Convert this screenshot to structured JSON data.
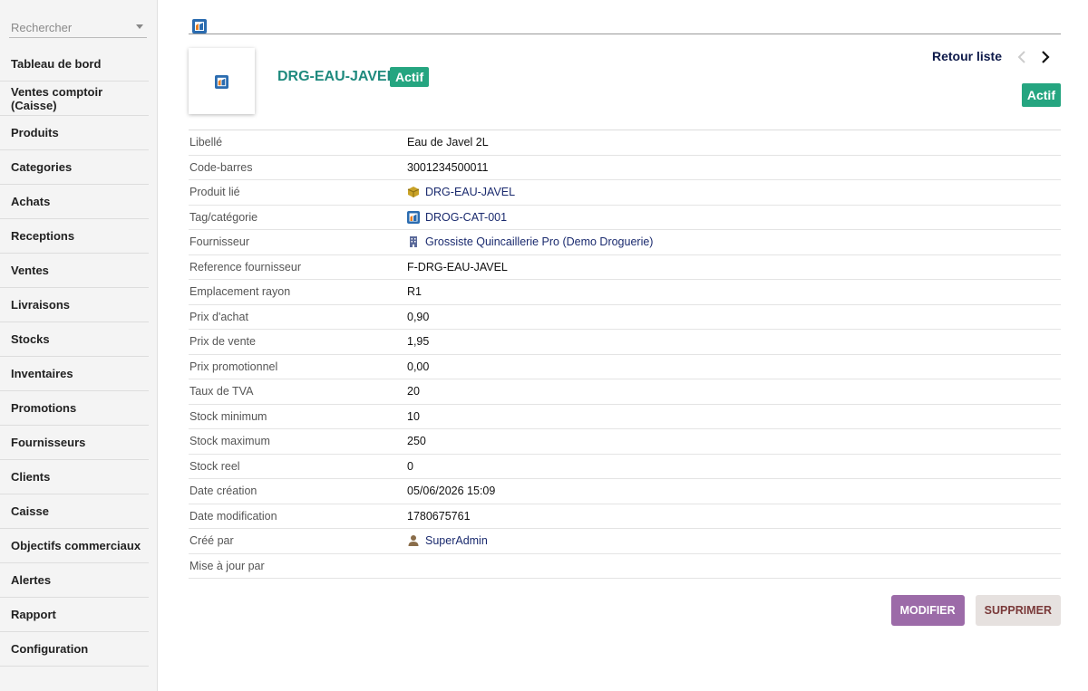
{
  "sidebar": {
    "search_placeholder": "Rechercher",
    "items": [
      {
        "label": "Tableau de bord",
        "name": "sidebar-item-tableau-de-bord"
      },
      {
        "label": "Ventes comptoir (Caisse)",
        "name": "sidebar-item-ventes-comptoir"
      },
      {
        "label": "Produits",
        "name": "sidebar-item-produits"
      },
      {
        "label": "Categories",
        "name": "sidebar-item-categories"
      },
      {
        "label": "Achats",
        "name": "sidebar-item-achats"
      },
      {
        "label": "Receptions",
        "name": "sidebar-item-receptions"
      },
      {
        "label": "Ventes",
        "name": "sidebar-item-ventes"
      },
      {
        "label": "Livraisons",
        "name": "sidebar-item-livraisons"
      },
      {
        "label": "Stocks",
        "name": "sidebar-item-stocks"
      },
      {
        "label": "Inventaires",
        "name": "sidebar-item-inventaires"
      },
      {
        "label": "Promotions",
        "name": "sidebar-item-promotions"
      },
      {
        "label": "Fournisseurs",
        "name": "sidebar-item-fournisseurs"
      },
      {
        "label": "Clients",
        "name": "sidebar-item-clients"
      },
      {
        "label": "Caisse",
        "name": "sidebar-item-caisse"
      },
      {
        "label": "Objectifs commerciaux",
        "name": "sidebar-item-objectifs"
      },
      {
        "label": "Alertes",
        "name": "sidebar-item-alertes"
      },
      {
        "label": "Rapport",
        "name": "sidebar-item-rapport"
      },
      {
        "label": "Configuration",
        "name": "sidebar-item-configuration"
      }
    ]
  },
  "header": {
    "ref": "DRG-EAU-JAVEL",
    "status_badge": "Actif",
    "status_badge_right": "Actif",
    "back_link": "Retour liste",
    "prev_icon": "chevron-left-icon",
    "next_icon": "chevron-right-icon"
  },
  "fields": [
    {
      "label": "Libellé",
      "value": "Eau de Javel 2L",
      "link": false,
      "icon": ""
    },
    {
      "label": "Code-barres",
      "value": "3001234500011",
      "link": false,
      "icon": ""
    },
    {
      "label": "Produit lié",
      "value": "DRG-EAU-JAVEL",
      "link": true,
      "icon": "box-icon"
    },
    {
      "label": "Tag/catégorie",
      "value": "DROG-CAT-001",
      "link": true,
      "icon": "app-logo-icon"
    },
    {
      "label": "Fournisseur",
      "value": "Grossiste Quincaillerie Pro (Demo Droguerie)",
      "link": true,
      "icon": "building-icon"
    },
    {
      "label": "Reference fournisseur",
      "value": "F-DRG-EAU-JAVEL",
      "link": false,
      "icon": ""
    },
    {
      "label": "Emplacement rayon",
      "value": "R1",
      "link": false,
      "icon": ""
    },
    {
      "label": "Prix d'achat",
      "value": "0,90",
      "link": false,
      "icon": ""
    },
    {
      "label": "Prix de vente",
      "value": "1,95",
      "link": false,
      "icon": ""
    },
    {
      "label": "Prix promotionnel",
      "value": "0,00",
      "link": false,
      "icon": ""
    },
    {
      "label": "Taux de TVA",
      "value": "20",
      "link": false,
      "icon": ""
    },
    {
      "label": "Stock minimum",
      "value": "10",
      "link": false,
      "icon": ""
    },
    {
      "label": "Stock maximum",
      "value": "250",
      "link": false,
      "icon": ""
    },
    {
      "label": "Stock reel",
      "value": "0",
      "link": false,
      "icon": ""
    },
    {
      "label": "Date création",
      "value": "05/06/2026 15:09",
      "link": false,
      "icon": ""
    },
    {
      "label": "Date modification",
      "value": "1780675761",
      "link": false,
      "icon": ""
    },
    {
      "label": "Créé par",
      "value": "SuperAdmin",
      "link": true,
      "icon": "user-icon"
    },
    {
      "label": "Mise à jour par",
      "value": "",
      "link": false,
      "icon": ""
    }
  ],
  "actions": {
    "modify": "MODIFIER",
    "delete": "SUPPRIMER"
  },
  "colors": {
    "accent_teal": "#1f8a7e",
    "badge_green": "#25a580",
    "modify_purple": "#9c6ba8",
    "link_navy": "#1a2a6e"
  }
}
